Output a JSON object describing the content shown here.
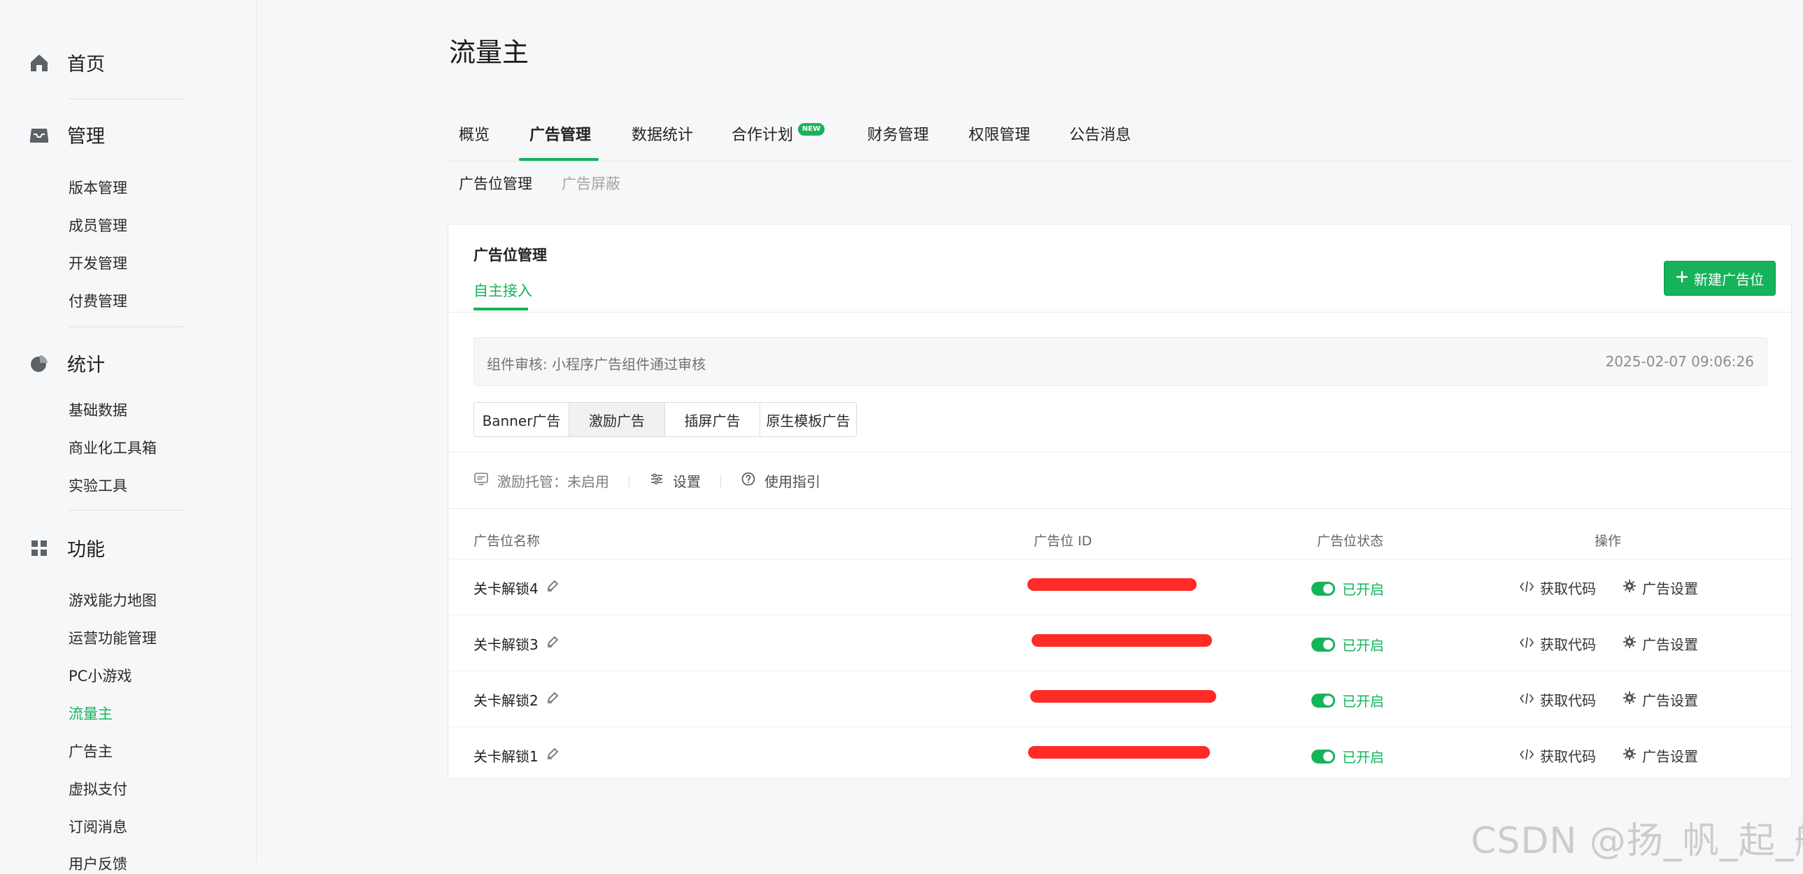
{
  "sidebar": {
    "sections": [
      {
        "label": "首页",
        "icon": "home-icon"
      },
      {
        "label": "管理",
        "icon": "inbox-icon"
      },
      {
        "label": "统计",
        "icon": "pie-chart-icon"
      },
      {
        "label": "功能",
        "icon": "grid-icon"
      }
    ],
    "items": {
      "manage": [
        "版本管理",
        "成员管理",
        "开发管理",
        "付费管理"
      ],
      "stats": [
        "基础数据",
        "商业化工具箱",
        "实验工具"
      ],
      "features": [
        "游戏能力地图",
        "运营功能管理",
        "PC小游戏",
        "流量主",
        "广告主",
        "虚拟支付",
        "订阅消息",
        "用户反馈"
      ]
    }
  },
  "page": {
    "title": "流量主"
  },
  "tabs": [
    "概览",
    "广告管理",
    "数据统计",
    "合作计划",
    "财务管理",
    "权限管理",
    "公告消息"
  ],
  "badge": "NEW",
  "subtabs": [
    "广告位管理",
    "广告屏蔽"
  ],
  "card": {
    "title": "广告位管理",
    "tab": "自主接入",
    "new_button": "新建广告位",
    "notice": "组件审核: 小程序广告组件通过审核",
    "notice_time": "2025-02-07 09:06:26",
    "segments": [
      "Banner广告",
      "激励广告",
      "插屏广告",
      "原生模板广告"
    ],
    "toolbar": {
      "hosting": "激励托管：未启用",
      "settings": "设置",
      "guide": "使用指引"
    },
    "columns": [
      "广告位名称",
      "广告位 ID",
      "广告位状态",
      "操作"
    ],
    "rows": [
      {
        "name": "关卡解锁4",
        "status": "已开启",
        "action1": "获取代码",
        "action2": "广告设置"
      },
      {
        "name": "关卡解锁3",
        "status": "已开启",
        "action1": "获取代码",
        "action2": "广告设置"
      },
      {
        "name": "关卡解锁2",
        "status": "已开启",
        "action1": "获取代码",
        "action2": "广告设置"
      },
      {
        "name": "关卡解锁1",
        "status": "已开启",
        "action1": "获取代码",
        "action2": "广告设置"
      }
    ]
  },
  "watermark": "CSDN @扬_帆_起_航",
  "colors": {
    "accent": "#15b35a",
    "redaction": "#ff2b24",
    "background": "#f6f7f9"
  }
}
